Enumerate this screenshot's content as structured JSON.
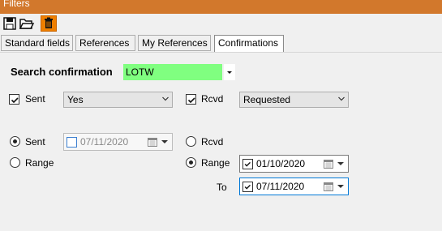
{
  "window": {
    "title": "Filters"
  },
  "toolbar": {
    "save_icon": "save-icon",
    "open_icon": "folder-open-icon",
    "delete_icon": "trash-icon",
    "delete_color": "#ef7f00"
  },
  "tabs": [
    {
      "label": "Standard fields",
      "active": false
    },
    {
      "label": "References",
      "active": false
    },
    {
      "label": "My References",
      "active": false
    },
    {
      "label": "Confirmations",
      "active": true
    }
  ],
  "search": {
    "label": "Search confirmation",
    "value": "LOTW",
    "highlight": "#80ff80"
  },
  "sent_filter": {
    "label": "Sent",
    "checked": true,
    "value": "Yes"
  },
  "rcvd_filter": {
    "label": "Rcvd",
    "checked": true,
    "value": "Requested"
  },
  "sent_date": {
    "radio_label": "Sent",
    "range_label": "Range",
    "date_value": "07/11/2020",
    "date_checked": false,
    "selected": "Sent"
  },
  "rcvd_date": {
    "radio_label": "Rcvd",
    "range_label": "Range",
    "from_value": "01/10/2020",
    "to_label": "To",
    "to_value": "07/11/2020",
    "selected": "Range"
  }
}
